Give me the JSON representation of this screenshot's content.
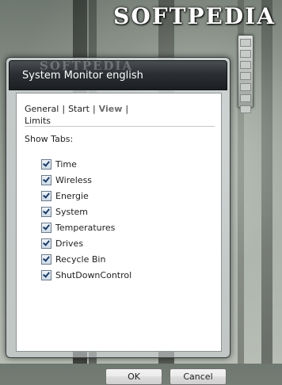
{
  "background": {
    "watermark": "SOFTPEDIA",
    "title_watermark": "SOFTPEDIA"
  },
  "dialog": {
    "title": "System Monitor english",
    "nav": {
      "items": [
        {
          "label": "General",
          "active": false
        },
        {
          "label": "Start",
          "active": false
        },
        {
          "label": "View",
          "active": true
        },
        {
          "label": "Limits",
          "active": false
        }
      ],
      "separator": "|"
    },
    "section_label": "Show Tabs:",
    "options": [
      {
        "label": "Time",
        "checked": true
      },
      {
        "label": "Wireless",
        "checked": true
      },
      {
        "label": "Energie",
        "checked": true
      },
      {
        "label": "System",
        "checked": true
      },
      {
        "label": "Temperatures",
        "checked": true
      },
      {
        "label": "Drives",
        "checked": true
      },
      {
        "label": "Recycle Bin",
        "checked": true
      },
      {
        "label": "ShutDownControl",
        "checked": true
      }
    ],
    "buttons": {
      "ok": "OK",
      "cancel": "Cancel"
    }
  },
  "colors": {
    "title_text": "#ffffff",
    "active_tab": "#6c6c6c",
    "panel_bg": "#ffffff"
  }
}
